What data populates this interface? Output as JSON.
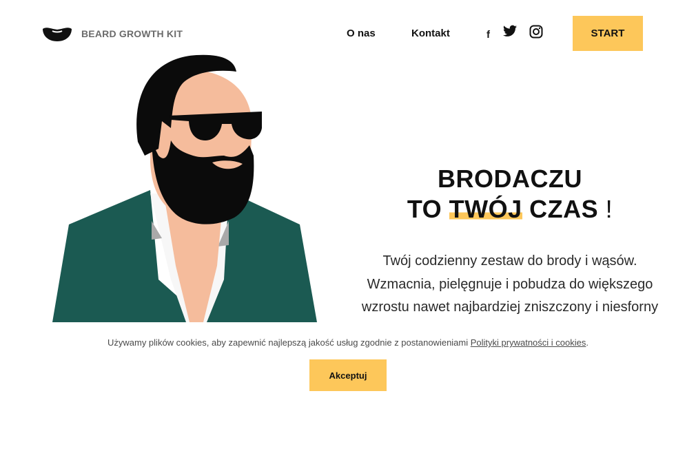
{
  "header": {
    "logo_text": "BEARD GROWTH KIT",
    "nav": {
      "about": "O nas",
      "contact": "Kontakt"
    },
    "social": {
      "facebook_glyph": "f",
      "icons": [
        "facebook-icon",
        "twitter-icon",
        "instagram-icon"
      ]
    },
    "start_label": "START"
  },
  "hero": {
    "headline_line1": "BRODACZU",
    "headline_prefix": "TO ",
    "headline_highlight": "TWÓJ",
    "headline_suffix": " CZAS",
    "headline_exclaim": " !",
    "description": "Twój codzienny zestaw do brody i wąsów. Wzmacnia, pielęgnuje i pobudza do większego wzrostu nawet najbardziej zniszczony i niesforny zarost."
  },
  "cookies": {
    "text": "Używamy plików cookies, aby zapewnić najlepszą jakość usług zgodnie z postanowieniami ",
    "link": "Polityki prywatności i cookies",
    "trailing": ".",
    "accept_label": "Akceptuj"
  },
  "colors": {
    "accent": "#fdc75a",
    "jacket": "#1b5a52",
    "skin": "#f5bc9c",
    "hair": "#0b0b0b"
  }
}
